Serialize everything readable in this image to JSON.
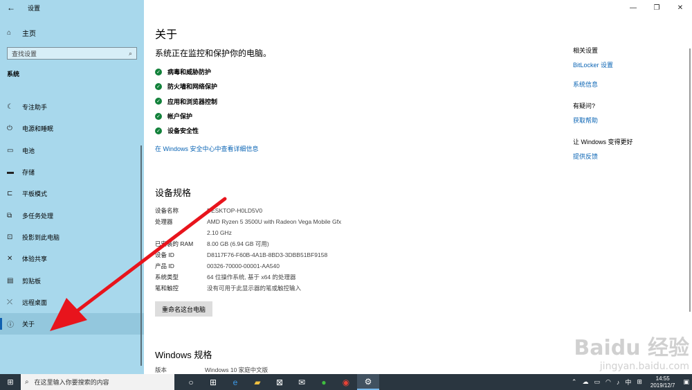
{
  "sidebar": {
    "back_icon": "back-arrow-icon",
    "window_title": "设置",
    "home_label": "主页",
    "search_placeholder": "查找设置",
    "section_title": "系统",
    "items": [
      {
        "label": "专注助手",
        "icon": "moon-icon"
      },
      {
        "label": "电源和睡眠",
        "icon": "power-icon"
      },
      {
        "label": "电池",
        "icon": "battery-icon"
      },
      {
        "label": "存储",
        "icon": "storage-icon"
      },
      {
        "label": "平板模式",
        "icon": "tablet-icon"
      },
      {
        "label": "多任务处理",
        "icon": "multitask-icon"
      },
      {
        "label": "投影到此电脑",
        "icon": "project-icon"
      },
      {
        "label": "体验共享",
        "icon": "share-icon"
      },
      {
        "label": "剪贴板",
        "icon": "clipboard-icon"
      },
      {
        "label": "远程桌面",
        "icon": "remote-icon"
      },
      {
        "label": "关于",
        "icon": "info-icon",
        "selected": true
      }
    ]
  },
  "main": {
    "title": "关于",
    "protect_heading": "系统正在监控和保护你的电脑。",
    "protections": [
      "病毒和威胁防护",
      "防火墙和网络保护",
      "应用和浏览器控制",
      "帐户保护",
      "设备安全性"
    ],
    "security_link": "在 Windows 安全中心中查看详细信息",
    "device_spec_title": "设备规格",
    "specs": [
      {
        "k": "设备名称",
        "v": "DESKTOP-H0LD5V0"
      },
      {
        "k": "处理器",
        "v": "AMD Ryzen 5 3500U with Radeon Vega Mobile Gfx"
      },
      {
        "k": "",
        "v": "2.10 GHz"
      },
      {
        "k": "已安装的 RAM",
        "v": "8.00 GB (6.94 GB 可用)"
      },
      {
        "k": "设备 ID",
        "v": "D8117F76-F60B-4A1B-8BD3-3DBB51BF9158"
      },
      {
        "k": "产品 ID",
        "v": "00326-70000-00001-AA540"
      },
      {
        "k": "系统类型",
        "v": "64 位操作系统, 基于 x64 的处理器"
      },
      {
        "k": "笔和触控",
        "v": "没有可用于此显示器的笔或触控输入"
      }
    ],
    "rename_button": "重命名这台电脑",
    "windows_spec_title": "Windows 规格",
    "windows_spec_row": {
      "k": "版本",
      "v": "Windows 10 家庭中文版"
    }
  },
  "related": {
    "heading": "相关设置",
    "links": [
      "BitLocker 设置",
      "系统信息"
    ],
    "question_heading": "有疑问?",
    "help_link": "获取帮助",
    "improve_heading": "让 Windows 变得更好",
    "feedback_link": "提供反馈"
  },
  "taskbar": {
    "search_placeholder": "在这里输入你要搜索的内容",
    "input_lang": "中",
    "time": "14:55",
    "date": "2019/12/7"
  },
  "watermark": {
    "brand": "Baidu 经验",
    "url": "jingyan.baidu.com"
  },
  "colors": {
    "sidebar": "#a8d8ec",
    "link": "#0a64b4",
    "arrow": "#e8141c",
    "check": "#12813a",
    "taskbar": "#2a3640"
  }
}
